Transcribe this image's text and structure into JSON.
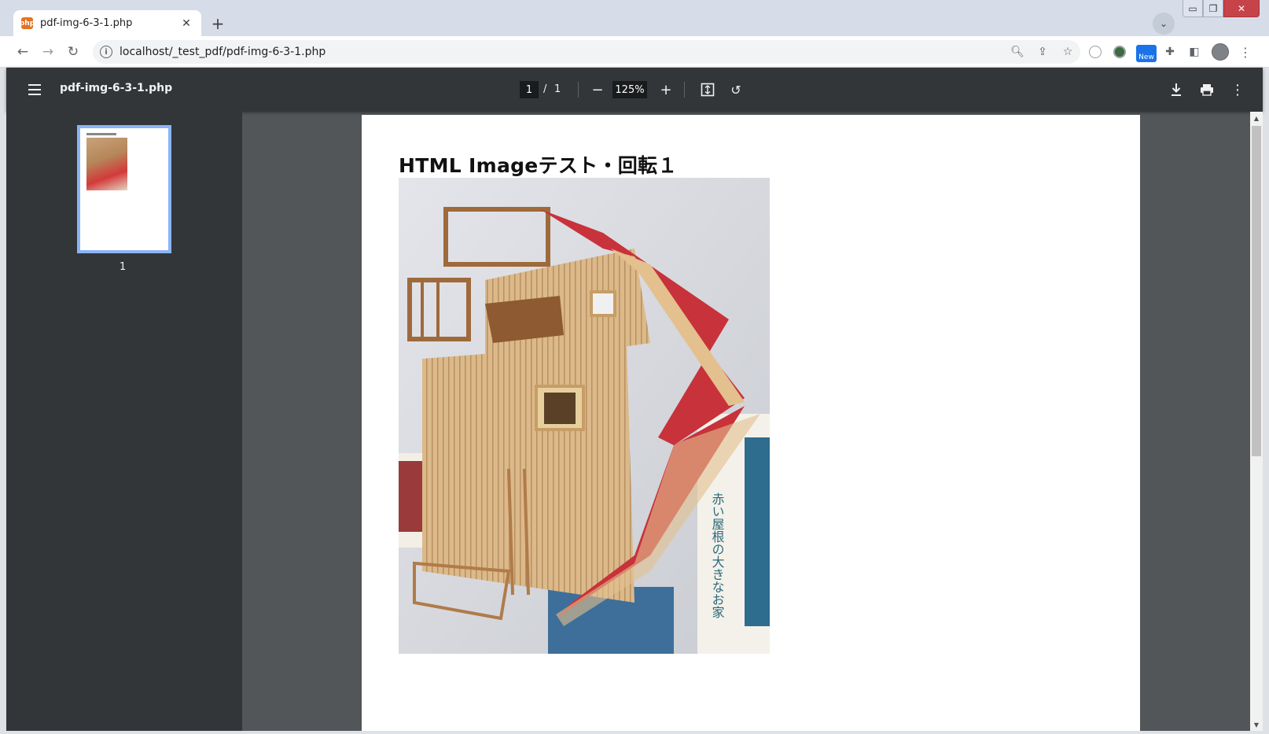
{
  "browser": {
    "tab_title": "pdf-img-6-3-1.php",
    "tab_favicon": "php-icon",
    "url": "localhost/_test_pdf/pdf-img-6-3-1.php",
    "new_badge": "New"
  },
  "viewer": {
    "file_name": "pdf-img-6-3-1.php",
    "current_page": "1",
    "page_separator": "/",
    "total_pages": "1",
    "zoom": "125%",
    "thumbnail_label": "1"
  },
  "document": {
    "title": "HTML Imageテスト・回転１",
    "image_description_icon": "photo-dollhouse",
    "box_text": "赤い屋根の大きなお家"
  },
  "colors": {
    "pdf_toolbar": "#323639",
    "pdf_background": "#525659",
    "thumbnail_border": "#8ab4f8",
    "roof_red": "#c8323a"
  }
}
